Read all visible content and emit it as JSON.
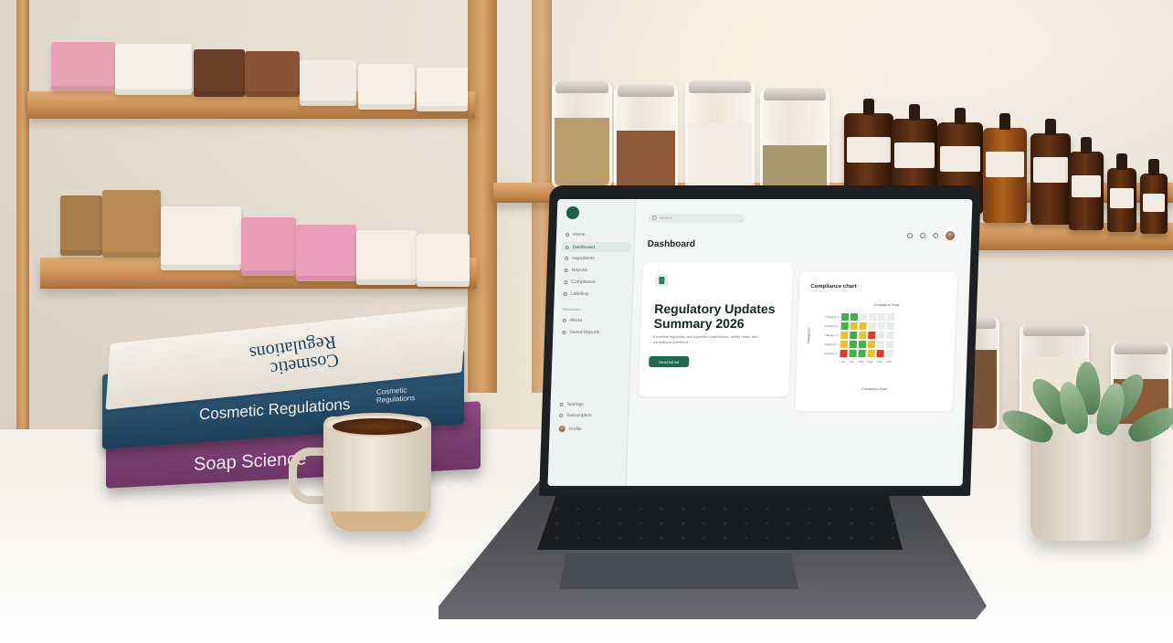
{
  "books": {
    "top_spine_title": "Cosmetic Regulations",
    "top_spine_small": "Cosmetic Regulations",
    "top_cover_title": "Cosmetic Regulations",
    "bottom_spine_title": "Soap Science"
  },
  "laptop_screen": {
    "search_placeholder": "Search",
    "sidebar": {
      "items": [
        {
          "label": "Home",
          "active": false
        },
        {
          "label": "Dashboard",
          "active": true
        },
        {
          "label": "Ingredients",
          "active": false
        },
        {
          "label": "Reports",
          "active": false
        },
        {
          "label": "Compliance",
          "active": false
        },
        {
          "label": "Labeling",
          "active": false
        }
      ],
      "section_label": "Resources",
      "section_items": [
        {
          "label": "About"
        },
        {
          "label": "Saved Reports"
        }
      ],
      "bottom_items": [
        {
          "label": "Settings"
        },
        {
          "label": "Subscription"
        },
        {
          "label": "Profile"
        }
      ]
    },
    "page_title": "Dashboard",
    "updates_card": {
      "title": "Regulatory Updates Summary 2026",
      "description": "Essential regulatory and ingredient restrictions, safety news, and compliance questions.",
      "button_label": "Read full list"
    },
    "chart_card": {
      "title": "Compliance chart",
      "chart_data": {
        "type": "heatmap",
        "title": "Compliance Chart",
        "xlabel": "Compliance Chart",
        "ylabel": "Categories",
        "y_categories": [
          "Category 1",
          "Category 2",
          "Category 3",
          "Category 4",
          "Category 5"
        ],
        "x_categories": [
          "Low",
          "Low",
          "Mod",
          "High",
          "High",
          "High"
        ],
        "values": [
          [
            1,
            1,
            0,
            0,
            0,
            0
          ],
          [
            1,
            2,
            2,
            0,
            0,
            0
          ],
          [
            2,
            1,
            2,
            3,
            0,
            0
          ],
          [
            2,
            1,
            1,
            2,
            0,
            0
          ],
          [
            3,
            1,
            1,
            2,
            3,
            0
          ]
        ],
        "legend_colors": {
          "0": "#e8eceb",
          "1": "#3fb24a",
          "2": "#f0c030",
          "3": "#e03a2f"
        }
      }
    }
  }
}
